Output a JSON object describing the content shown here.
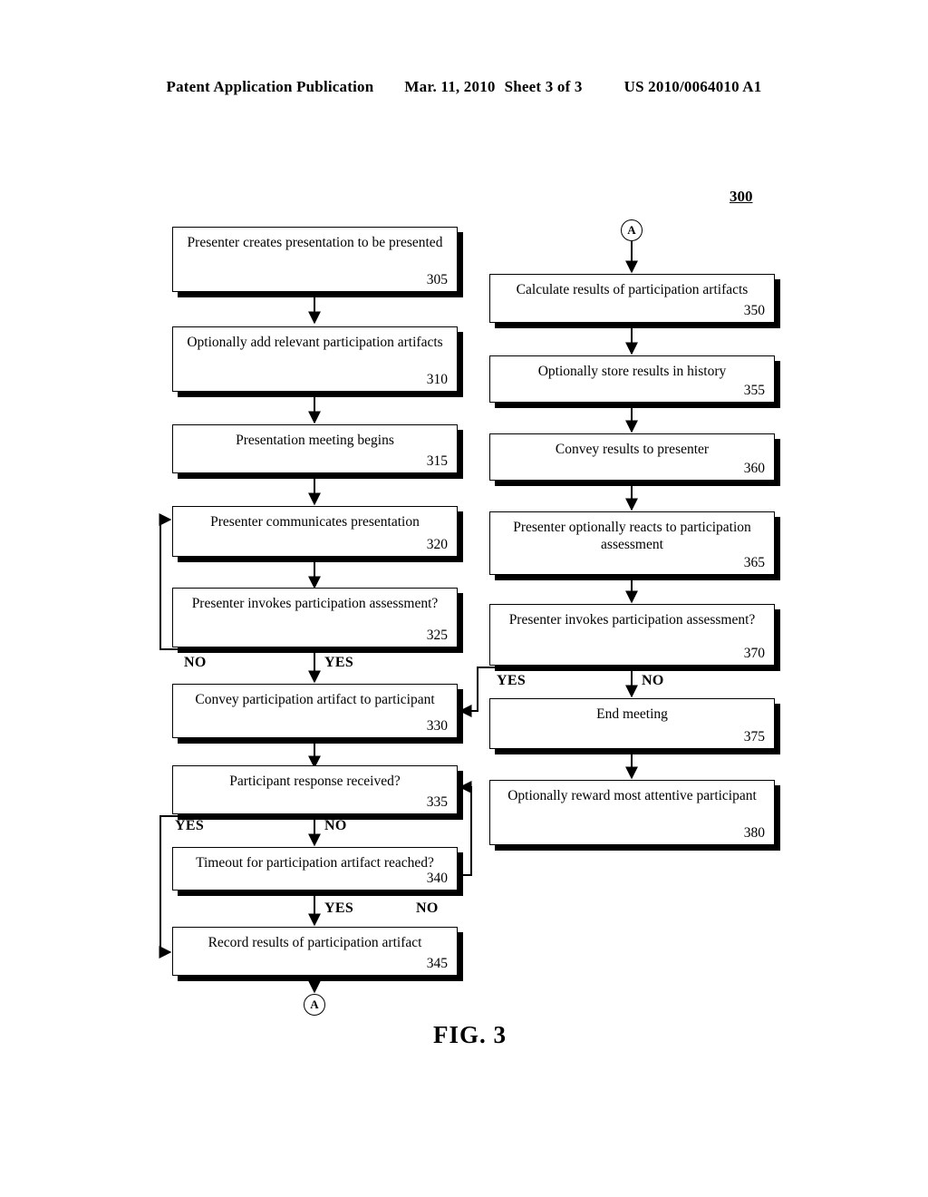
{
  "header": {
    "publication": "Patent Application Publication",
    "date": "Mar. 11, 2010",
    "sheet": "Sheet 3 of 3",
    "patent_number": "US 2010/0064010 A1"
  },
  "figure": {
    "caption": "FIG. 3",
    "flow_reference": "300",
    "connector_label": "A"
  },
  "boxes": [
    {
      "id": "305",
      "text": "Presenter creates presentation to be presented",
      "num": "305"
    },
    {
      "id": "310",
      "text": "Optionally add relevant participation artifacts",
      "num": "310"
    },
    {
      "id": "315",
      "text": "Presentation meeting begins",
      "num": "315"
    },
    {
      "id": "320",
      "text": "Presenter communicates presentation",
      "num": "320"
    },
    {
      "id": "325",
      "text": "Presenter invokes participation assessment?",
      "num": "325"
    },
    {
      "id": "330",
      "text": "Convey participation artifact to participant",
      "num": "330"
    },
    {
      "id": "335",
      "text": "Participant response received?",
      "num": "335"
    },
    {
      "id": "340",
      "text": "Timeout for participation artifact reached?",
      "num": "340"
    },
    {
      "id": "345",
      "text": "Record results of participation artifact",
      "num": "345"
    },
    {
      "id": "350",
      "text": "Calculate results of participation artifacts",
      "num": "350"
    },
    {
      "id": "355",
      "text": "Optionally store results in history",
      "num": "355"
    },
    {
      "id": "360",
      "text": "Convey results to presenter",
      "num": "360"
    },
    {
      "id": "365",
      "text": "Presenter optionally reacts to participation assessment",
      "num": "365"
    },
    {
      "id": "370",
      "text": "Presenter invokes participation assessment?",
      "num": "370"
    },
    {
      "id": "375",
      "text": "End meeting",
      "num": "375"
    },
    {
      "id": "380",
      "text": "Optionally reward most attentive participant",
      "num": "380"
    }
  ],
  "branch_labels": {
    "b325_no": "NO",
    "b325_yes": "YES",
    "b335_yes": "YES",
    "b335_no": "NO",
    "b340_yes": "YES",
    "b340_no": "NO",
    "b370_yes": "YES",
    "b370_no": "NO"
  },
  "connectors": {
    "top_a": "A",
    "bottom_a": "A"
  }
}
